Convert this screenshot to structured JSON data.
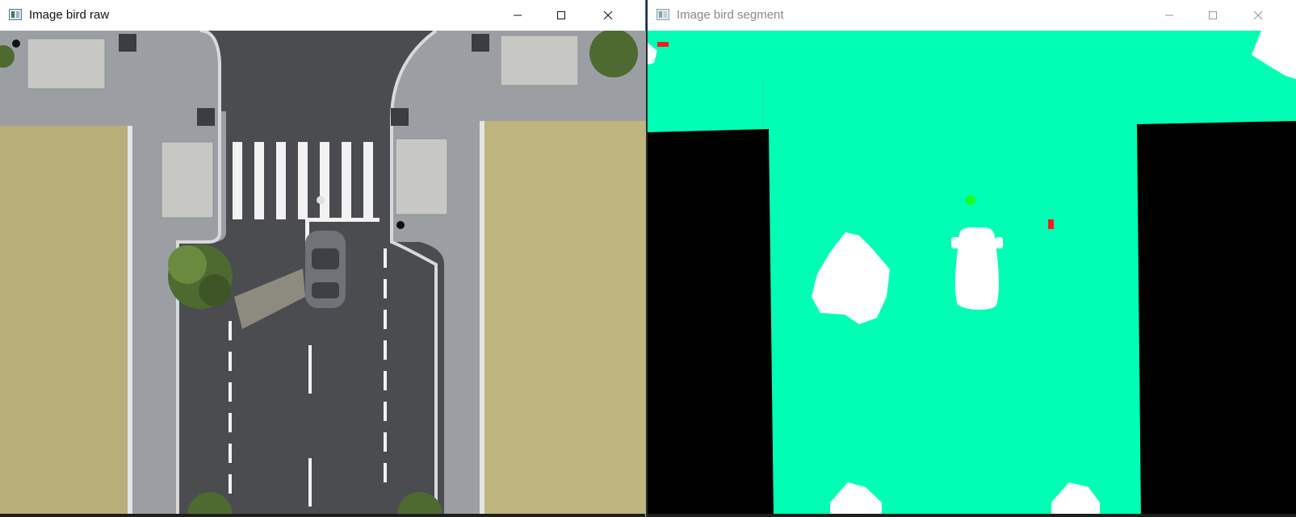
{
  "windows": [
    {
      "title": "Image bird raw",
      "controls": [
        "minimize-icon",
        "maximize-icon",
        "close-icon"
      ]
    },
    {
      "title": "Image bird segment",
      "controls": [
        "minimize-icon",
        "maximize-icon",
        "close-icon"
      ]
    }
  ],
  "colors": {
    "road": "#4a4c50",
    "sidewalk": "#9b9fa4",
    "grass": "#b7ae7a",
    "lane_marking": "#ffffff",
    "seg_drivable": "#00ffb4",
    "seg_building": "#000000",
    "seg_vegetation": "#ffffff",
    "seg_vehicle": "#ffffff",
    "seg_pedestrian_red": "#ff1a1a",
    "seg_pedestrian_green": "#19ff19"
  }
}
